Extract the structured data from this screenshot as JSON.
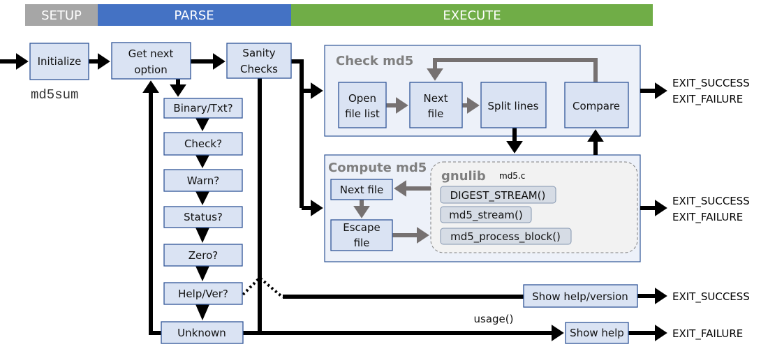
{
  "phases": [
    {
      "label": "SETUP",
      "color": "#a6a6a6"
    },
    {
      "label": "PARSE",
      "color": "#4472c4"
    },
    {
      "label": "EXECUTE",
      "color": "#70ad47"
    }
  ],
  "setup": {
    "initialize": "Initialize",
    "program": "md5sum"
  },
  "parse": {
    "get_next_line1": "Get next",
    "get_next_line2": "option",
    "sanity_line1": "Sanity",
    "sanity_line2": "Checks",
    "options": [
      "Binary/Txt?",
      "Check?",
      "Warn?",
      "Status?",
      "Zero?",
      "Help/Ver?",
      "Unknown"
    ]
  },
  "check_md5": {
    "title": "Check md5",
    "open_line1": "Open",
    "open_line2": "file list",
    "next_line1": "Next",
    "next_line2": "file",
    "split": "Split lines",
    "compare": "Compare"
  },
  "compute_md5": {
    "title": "Compute md5",
    "next_file": "Next file",
    "escape_line1": "Escape",
    "escape_line2": "file",
    "gnulib": {
      "title": "gnulib",
      "file": "md5.c",
      "functions": [
        "DIGEST_STREAM()",
        "md5_stream()",
        "md5_process_block()"
      ]
    }
  },
  "exits": {
    "success": "EXIT_SUCCESS",
    "failure": "EXIT_FAILURE"
  },
  "help": {
    "show_help_version": "Show help/version",
    "show_help": "Show help",
    "usage": "usage()"
  }
}
